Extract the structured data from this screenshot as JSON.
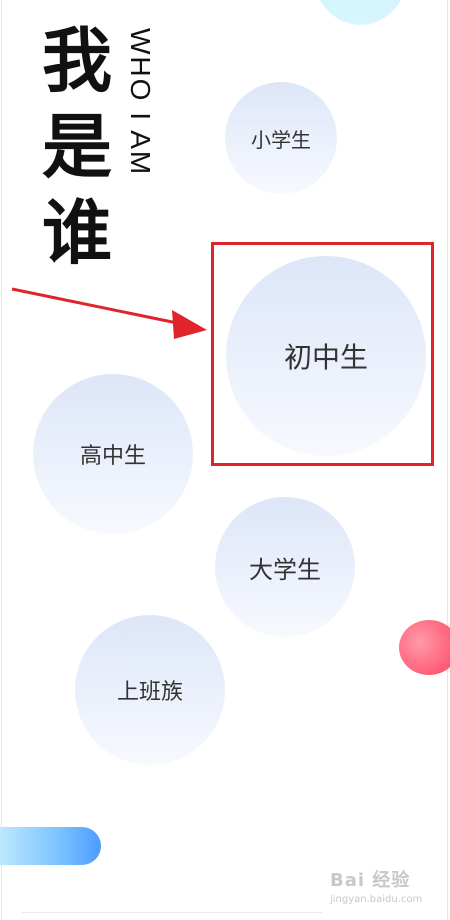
{
  "heading": {
    "chinese_chars": [
      "我",
      "是",
      "谁"
    ],
    "english": "WHO I AM"
  },
  "options": [
    {
      "label": "小学生"
    },
    {
      "label": "初中生",
      "highlighted": true
    },
    {
      "label": "高中生"
    },
    {
      "label": "大学生"
    },
    {
      "label": "上班族"
    }
  ],
  "annotation": {
    "highlight_color": "#e0242b",
    "arrow_color": "#e0242b",
    "arrow_target": "初中生"
  },
  "watermark": {
    "main": "Bai 经验",
    "sub": "jingyan.baidu.com"
  }
}
